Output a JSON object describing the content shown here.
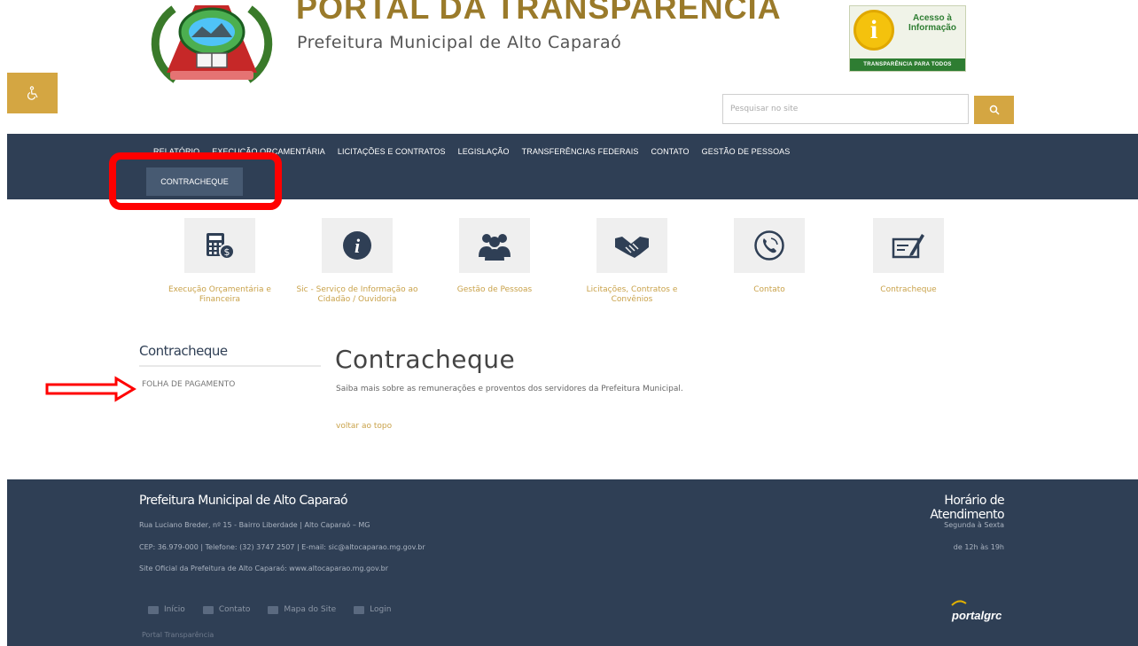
{
  "header": {
    "portal_title": "PORTAL DA TRANSPARÊNCIA",
    "portal_subtitle": "Prefeitura Municipal de Alto Caparaó",
    "info_badge": {
      "title": "Acesso à Informação",
      "strip": "TRANSPARÊNCIA PARA TODOS",
      "icon": "info-icon"
    },
    "accessibility_icon": "wheelchair-icon",
    "search": {
      "placeholder": "Pesquisar no site",
      "button_icon": "search-icon"
    }
  },
  "nav": {
    "items": [
      "RELATÓRIO",
      "EXECUÇÃO ORÇAMENTÁRIA",
      "LICITAÇÕES E CONTRATOS",
      "LEGISLAÇÃO",
      "TRANSFERÊNCIAS FEDERAIS",
      "CONTATO",
      "GESTÃO DE PESSOAS"
    ],
    "active": "CONTRACHEQUE"
  },
  "quick_links": [
    {
      "icon": "calculator-money-icon",
      "label": "Execução Orçamentária e Financeira"
    },
    {
      "icon": "info-circle-icon",
      "label": "Sic - Serviço de Informação ao Cidadão / Ouvidoria"
    },
    {
      "icon": "people-group-icon",
      "label": "Gestão de Pessoas"
    },
    {
      "icon": "handshake-icon",
      "label": "Licitações, Contratos e Convênios"
    },
    {
      "icon": "phone-icon",
      "label": "Contato"
    },
    {
      "icon": "paycheck-pen-icon",
      "label": "Contracheque"
    }
  ],
  "sidebar": {
    "title": "Contracheque",
    "items": [
      "FOLHA DE PAGAMENTO"
    ]
  },
  "content": {
    "title": "Contracheque",
    "description": "Saiba mais sobre as remunerações e proventos dos servidores da Prefeitura Municipal.",
    "back_to_top": "voltar ao topo"
  },
  "footer": {
    "name": "Prefeitura Municipal de Alto Caparaó",
    "address": "Rua Luciano Breder, nº 15 - Bairro Liberdade  |  Alto Caparaó – MG",
    "contacts": "CEP: 36.979-000  |  Telefone: (32) 3747 2507  |  E-mail: sic@altocaparao.mg.gov.br",
    "site": "Site Oficial da Prefeitura de Alto Caparaó: www.altocaparao.mg.gov.br",
    "hours_title": "Horário de Atendimento",
    "hours_days": "Segunda à Sexta",
    "hours_time": "de 12h às 19h",
    "links": [
      {
        "icon": "home-icon",
        "label": "Início"
      },
      {
        "icon": "mail-icon",
        "label": "Contato"
      },
      {
        "icon": "sitemap-icon",
        "label": "Mapa do Site"
      },
      {
        "icon": "login-icon",
        "label": "Login"
      }
    ],
    "portal_label": "Portal Transparência",
    "logo_text": "portalgrc"
  },
  "colors": {
    "navy": "#2f3f55",
    "gold": "#d4a642",
    "highlight_red": "#ff0000"
  }
}
